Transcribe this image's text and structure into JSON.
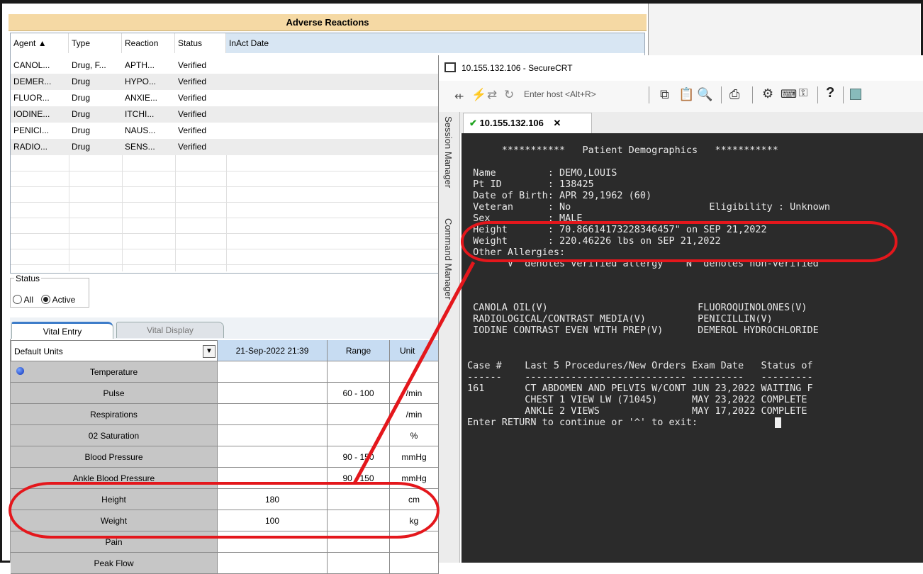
{
  "adverse_reactions": {
    "title": "Adverse Reactions",
    "columns": [
      "Agent ▲",
      "Type",
      "Reaction",
      "Status",
      "InAct Date"
    ],
    "rows": [
      [
        "CANOL...",
        "Drug, F...",
        "APTH...",
        "Verified"
      ],
      [
        "DEMER...",
        "Drug",
        "HYPO...",
        "Verified"
      ],
      [
        "FLUOR...",
        "Drug",
        "ANXIE...",
        "Verified"
      ],
      [
        "IODINE...",
        "Drug",
        "ITCHI...",
        "Verified"
      ],
      [
        "PENICI...",
        "Drug",
        "NAUS...",
        "Verified"
      ],
      [
        "RADIO...",
        "Drug",
        "SENS...",
        "Verified"
      ]
    ]
  },
  "status": {
    "legend": "Status",
    "options": [
      "All",
      "Active"
    ],
    "selected": "Active"
  },
  "tabs": [
    "Vital Entry",
    "Vital Display"
  ],
  "vitals": {
    "units_select": "Default Units",
    "date_col": "21-Sep-2022 21:39",
    "range_col": "Range",
    "unit_col": "Unit",
    "rows": [
      {
        "label": "Temperature",
        "value": "",
        "range": "",
        "unit": ""
      },
      {
        "label": "Pulse",
        "value": "",
        "range": "60 - 100",
        "unit": "/min"
      },
      {
        "label": "Respirations",
        "value": "",
        "range": "",
        "unit": "/min"
      },
      {
        "label": "02 Saturation",
        "value": "",
        "range": "",
        "unit": "%"
      },
      {
        "label": "Blood Pressure",
        "value": "",
        "range": "90 - 150",
        "unit": "mmHg"
      },
      {
        "label": "Ankle Blood Pressure",
        "value": "",
        "range": "90 - 150",
        "unit": "mmHg"
      },
      {
        "label": "Height",
        "value": "180",
        "range": "",
        "unit": "cm"
      },
      {
        "label": "Weight",
        "value": "100",
        "range": "",
        "unit": "kg"
      },
      {
        "label": "Pain",
        "value": "",
        "range": "",
        "unit": ""
      },
      {
        "label": "Peak Flow",
        "value": "",
        "range": "",
        "unit": ""
      }
    ]
  },
  "securecrt": {
    "title": "10.155.132.106 - SecureCRT",
    "host_placeholder": "Enter host <Alt+R>",
    "tab_label": "10.155.132.106",
    "sidebar": [
      "Session Manager",
      "Command Manager"
    ],
    "terminal_lines": [
      "      ***********   Patient Demographics   ***********",
      "",
      " Name         : DEMO,LOUIS",
      " Pt ID        : 138425",
      " Date of Birth: APR 29,1962 (60)",
      " Veteran      : No                        Eligibility : Unknown",
      " Sex          : MALE",
      " Height       : 70.86614173228346457\" on SEP 21,2022",
      " Weight       : 220.46226 lbs on SEP 21,2022",
      " Other Allergies:",
      "      'V' denotes verified allergy   'N' denotes non-verified",
      "",
      " CANOLA OIL(V)                          FLUOROQUINOLONES(V)",
      " RADIOLOGICAL/CONTRAST MEDIA(V)         PENICILLIN(V)",
      " IODINE CONTRAST EVEN WITH PREP(V)      DEMEROL HYDROCHLORIDE",
      "",
      "Case #    Last 5 Procedures/New Orders Exam Date   Status of",
      "------    ---------------------------- ---------   ---------",
      "161       CT ABDOMEN AND PELVIS W/CONT JUN 23,2022 WAITING F",
      "          CHEST 1 VIEW LW (71045)      MAY 23,2022 COMPLETE",
      "          ANKLE 2 VIEWS                MAY 17,2022 COMPLETE",
      "Enter RETURN to continue or '^' to exit: "
    ]
  },
  "colors": {
    "annotation": "#e4171c",
    "header_bg": "#f5d9a4",
    "terminal_bg": "#2b2b2b"
  }
}
